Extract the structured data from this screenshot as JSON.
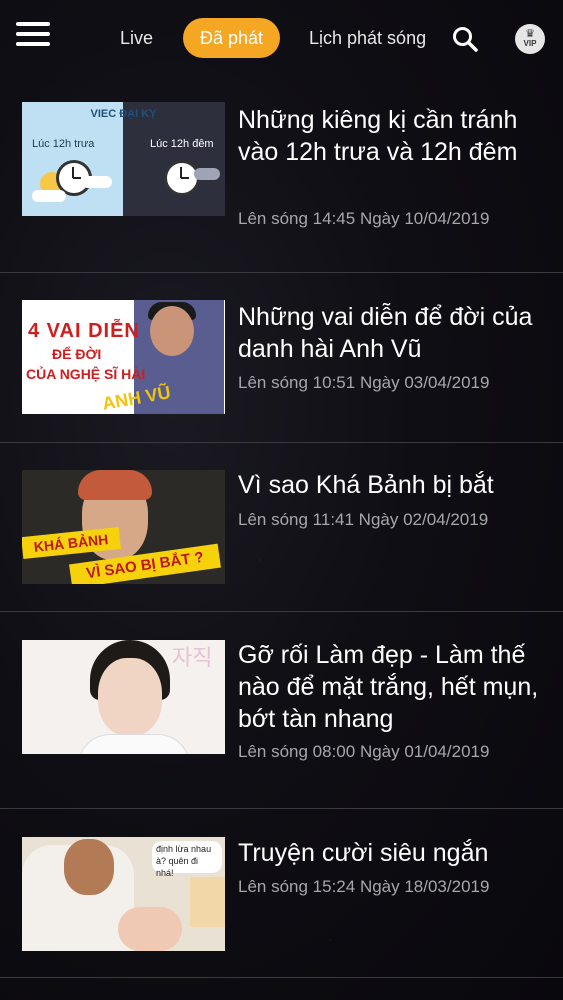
{
  "header": {
    "menu_icon": "hamburger-menu-icon",
    "tabs": [
      {
        "label": "Live",
        "active": false
      },
      {
        "label": "Đã phát",
        "active": true
      },
      {
        "label": "Lịch phát sóng",
        "active": false
      }
    ],
    "search_icon": "search-icon",
    "vip_badge": "VIP",
    "accent_color": "#f5a623"
  },
  "videos": [
    {
      "title": "Những kiêng kị cần tránh vào 12h trưa và 12h đêm",
      "meta": "Lên sóng 14:45 Ngày 10/04/2019",
      "thumb_text": [
        "VIEC ĐẠI KỴ",
        "Lúc 12h trưa",
        "Lúc 12h đêm"
      ]
    },
    {
      "title": "Những vai diễn để đời của danh hài Anh Vũ",
      "meta": "Lên sóng 10:51 Ngày 03/04/2019",
      "thumb_text": [
        "4 VAI DIỄN",
        "ĐỂ ĐỜI",
        "CỦA NGHỆ SĨ HÀI",
        "ANH VŨ"
      ]
    },
    {
      "title": "Vì sao Khá Bảnh bị bắt",
      "meta": "Lên sóng 11:41 Ngày 02/04/2019",
      "thumb_text": [
        "KHÁ BẢNH",
        "VÌ SAO BỊ BẮT ?"
      ]
    },
    {
      "title": "Gỡ rối Làm đẹp - Làm thế nào để mặt trắng, hết mụn, bớt tàn nhang",
      "meta": "Lên sóng 08:00 Ngày 01/04/2019",
      "thumb_text": [
        "자직"
      ]
    },
    {
      "title": "Truyện cười siêu ngắn",
      "meta": "Lên sóng 15:24 Ngày 18/03/2019",
      "thumb_text": [
        "định lừa nhau à? quên đi nhá!"
      ]
    }
  ]
}
